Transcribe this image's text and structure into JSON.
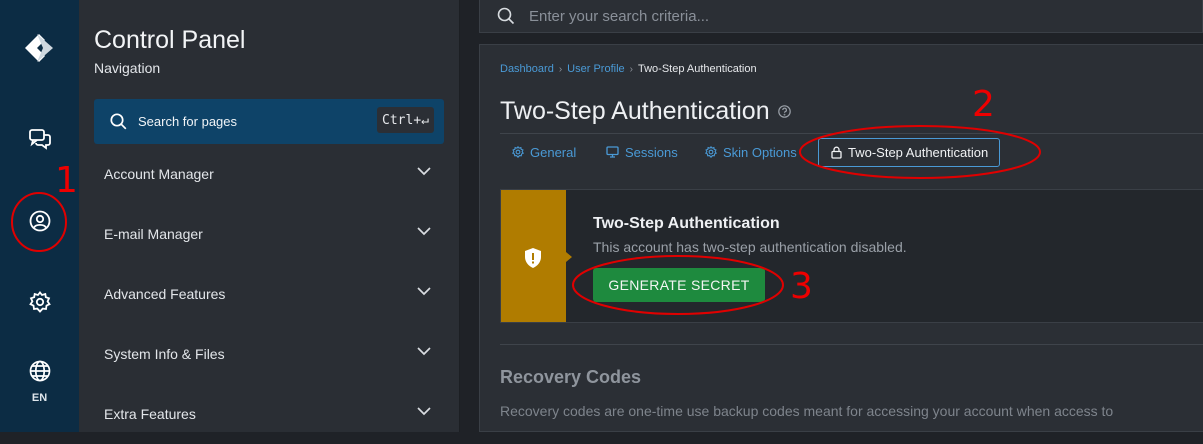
{
  "rail": {
    "lang": "EN"
  },
  "nav": {
    "title": "Control Panel",
    "subtitle": "Navigation",
    "search_label": "Search for pages",
    "search_shortcut": "Ctrl+↵",
    "items": [
      {
        "label": "Account Manager"
      },
      {
        "label": "E-mail Manager"
      },
      {
        "label": "Advanced Features"
      },
      {
        "label": "System Info & Files"
      },
      {
        "label": "Extra Features"
      }
    ]
  },
  "topbar": {
    "search_placeholder": "Enter your search criteria..."
  },
  "breadcrumb": {
    "items": [
      "Dashboard",
      "User Profile"
    ],
    "current": "Two-Step Authentication"
  },
  "page": {
    "title": "Two-Step Authentication"
  },
  "tabs": [
    {
      "label": "General",
      "icon": "gear-icon"
    },
    {
      "label": "Sessions",
      "icon": "monitor-icon"
    },
    {
      "label": "Skin Options",
      "icon": "gear-icon"
    },
    {
      "label": "Two-Step Authentication",
      "icon": "lock-icon",
      "active": true
    }
  ],
  "two_step": {
    "title": "Two-Step Authentication",
    "description": "This account has two-step authentication disabled.",
    "button": "GENERATE SECRET"
  },
  "recovery": {
    "title": "Recovery Codes",
    "description": "Recovery codes are one-time use backup codes meant for accessing your account when access to"
  },
  "annotations": {
    "step1": "1",
    "step2": "2",
    "step3": "3"
  },
  "colors": {
    "rail": "#0c2c44",
    "accent": "#4a9ad6",
    "warning": "#b07c00",
    "success": "#1e8a3e",
    "annotation": "#e00000"
  }
}
